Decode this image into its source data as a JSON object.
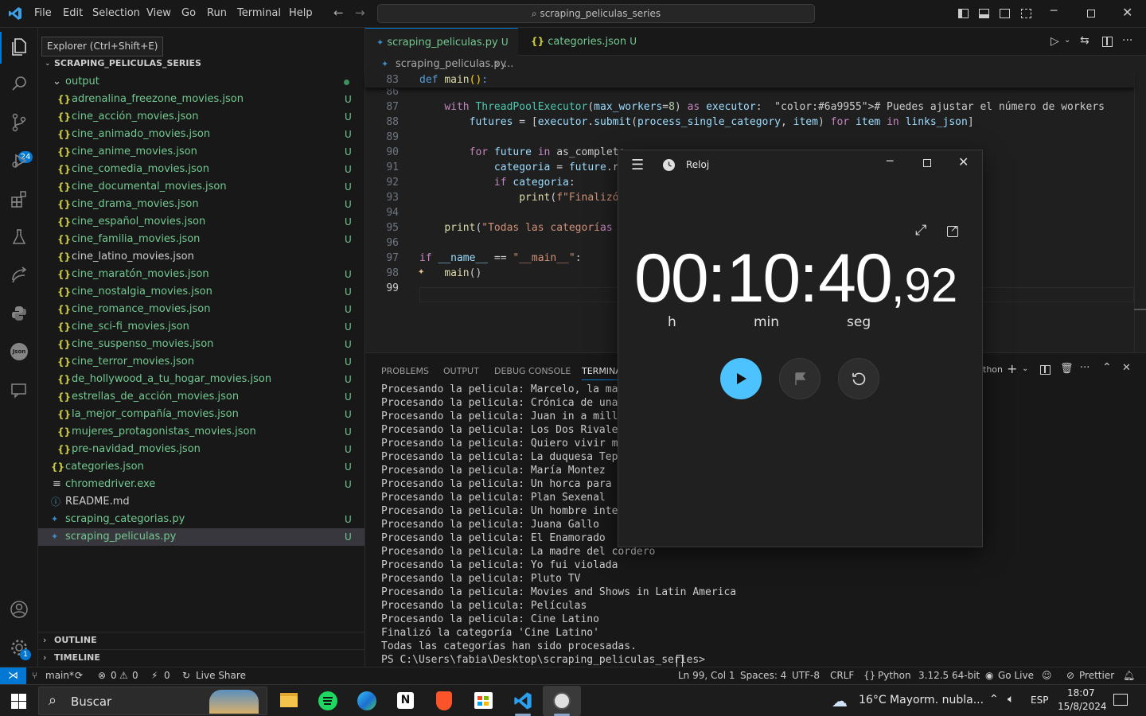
{
  "menu": [
    "File",
    "Edit",
    "Selection",
    "View",
    "Go",
    "Run",
    "Terminal",
    "Help"
  ],
  "search": {
    "text": "scraping_peliculas_series"
  },
  "tooltip": "Explorer (Ctrl+Shift+E)",
  "activity": {
    "scm_badge": "24",
    "settings_badge": "1"
  },
  "sidebar": {
    "root": "SCRAPING_PELICULAS_SERIES",
    "folder": "output",
    "files": [
      {
        "name": "adrenalina_freezone_movies.json",
        "badge": "U"
      },
      {
        "name": "cine_acción_movies.json",
        "badge": "U"
      },
      {
        "name": "cine_animado_movies.json",
        "badge": "U"
      },
      {
        "name": "cine_anime_movies.json",
        "badge": "U"
      },
      {
        "name": "cine_comedia_movies.json",
        "badge": "U"
      },
      {
        "name": "cine_documental_movies.json",
        "badge": "U"
      },
      {
        "name": "cine_drama_movies.json",
        "badge": "U"
      },
      {
        "name": "cine_español_movies.json",
        "badge": "U"
      },
      {
        "name": "cine_familia_movies.json",
        "badge": "U"
      },
      {
        "name": "cine_latino_movies.json",
        "badge": ""
      },
      {
        "name": "cine_maratón_movies.json",
        "badge": "U"
      },
      {
        "name": "cine_nostalgia_movies.json",
        "badge": "U"
      },
      {
        "name": "cine_romance_movies.json",
        "badge": "U"
      },
      {
        "name": "cine_sci-fi_movies.json",
        "badge": "U"
      },
      {
        "name": "cine_suspenso_movies.json",
        "badge": "U"
      },
      {
        "name": "cine_terror_movies.json",
        "badge": "U"
      },
      {
        "name": "de_hollywood_a_tu_hogar_movies.json",
        "badge": "U"
      },
      {
        "name": "estrellas_de_acción_movies.json",
        "badge": "U"
      },
      {
        "name": "la_mejor_compañía_movies.json",
        "badge": "U"
      },
      {
        "name": "mujeres_protagonistas_movies.json",
        "badge": "U"
      },
      {
        "name": "pre-navidad_movies.json",
        "badge": "U"
      }
    ],
    "root_files": [
      {
        "name": "categories.json",
        "badge": "U",
        "icon": "json"
      },
      {
        "name": "chromedriver.exe",
        "badge": "U",
        "icon": "exe"
      },
      {
        "name": "README.md",
        "badge": "",
        "icon": "info"
      },
      {
        "name": "scraping_categorias.py",
        "badge": "U",
        "icon": "py"
      },
      {
        "name": "scraping_peliculas.py",
        "badge": "U",
        "icon": "py"
      }
    ],
    "outline": "OUTLINE",
    "timeline": "TIMELINE"
  },
  "tabs": [
    {
      "label": "scraping_peliculas.py",
      "badge": "U"
    },
    {
      "label": "categories.json",
      "badge": "U"
    }
  ],
  "breadcrumb": {
    "file": "scraping_peliculas.py",
    "rest": "..."
  },
  "editor": {
    "sticky": {
      "num": "83",
      "code": "def main():"
    },
    "lines": [
      {
        "num": "86",
        "code": ""
      },
      {
        "num": "87",
        "code": "    with ThreadPoolExecutor(max_workers=8) as executor:  # Puedes ajustar el número de workers"
      },
      {
        "num": "88",
        "code": "        futures = [executor.submit(process_single_category, item) for item in links_json]"
      },
      {
        "num": "89",
        "code": ""
      },
      {
        "num": "90",
        "code": "        for future in as_complete"
      },
      {
        "num": "91",
        "code": "            categoria = future.re"
      },
      {
        "num": "92",
        "code": "            if categoria:"
      },
      {
        "num": "93",
        "code": "                print(f\"Finalizó"
      },
      {
        "num": "94",
        "code": ""
      },
      {
        "num": "95",
        "code": "    print(\"Todas las categorías h"
      },
      {
        "num": "96",
        "code": ""
      },
      {
        "num": "97",
        "code": "if __name__ == \"__main__\":"
      },
      {
        "num": "98",
        "code": "    main()"
      },
      {
        "num": "99",
        "code": ""
      }
    ]
  },
  "panel": {
    "tabs": [
      "PROBLEMS",
      "OUTPUT",
      "DEBUG CONSOLE",
      "TERMINA"
    ],
    "shell_label": "thon",
    "terminal": [
      "Procesando la pelicula: Marcelo, la mafia y",
      "Procesando la pelicula: Crónica de una desp",
      "Procesando la pelicula: Juan in a million",
      "Procesando la pelicula: Los Dos Rivales",
      "Procesando la pelicula: Quiero vivir mi vid",
      "Procesando la pelicula: La duquesa Tepetate",
      "Procesando la pelicula: María Montez",
      "Procesando la pelicula: Un horca para el to",
      "Procesando la pelicula: Plan Sexenal",
      "Procesando la pelicula: Un hombre interesan",
      "Procesando la pelicula: Juana Gallo",
      "Procesando la pelicula: El Enamorado",
      "Procesando la pelicula: La madre del cordero",
      "Procesando la pelicula: Yo fui violada",
      "Procesando la pelicula: Pluto TV",
      "Procesando la pelicula: Movies and Shows in Latin America",
      "Procesando la pelicula: Películas",
      "Procesando la pelicula: Cine Latino",
      "Finalizó la categoría 'Cine Latino'",
      "Todas las categorías han sido procesadas.",
      "PS C:\\Users\\fabia\\Desktop\\scraping_peliculas_series> "
    ]
  },
  "status": {
    "branch": "main*",
    "errors": "0",
    "warnings": "0",
    "ports": "0",
    "live_share": "Live Share",
    "position": "Ln 99, Col 1",
    "spaces": "Spaces: 4",
    "encoding": "UTF-8",
    "eol": "CRLF",
    "language": "Python",
    "interpreter": "3.12.5 64-bit",
    "go_live": "Go Live",
    "prettier": "Prettier"
  },
  "clock": {
    "title": "Reloj",
    "hours": "00",
    "minutes": "10",
    "seconds": "40",
    "hundredths": ",92",
    "label_h": "h",
    "label_min": "min",
    "label_seg": "seg"
  },
  "taskbar": {
    "search": "Buscar",
    "weather": "16°C  Mayorm. nubla...",
    "lang": "ESP",
    "time": "18:07",
    "date": "15/8/2024"
  },
  "colors": {
    "accent": "#0078d4",
    "untracked": "#73c991",
    "clock_play": "#4cc2ff"
  }
}
